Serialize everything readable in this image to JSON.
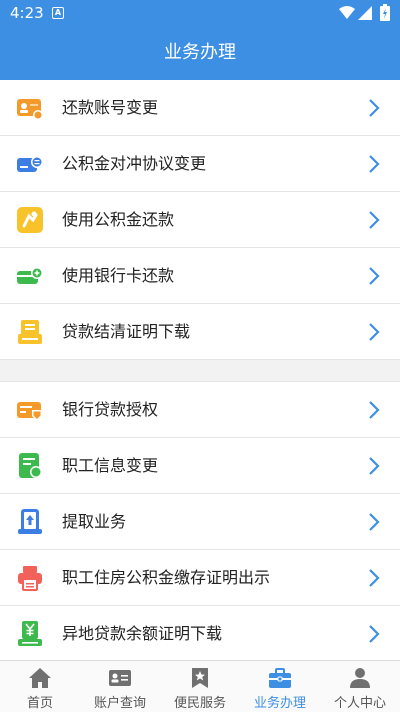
{
  "status": {
    "time": "4:23",
    "notif_badge": "A"
  },
  "header": {
    "title": "业务办理"
  },
  "section1": [
    {
      "label": "还款账号变更",
      "icon": "account-card-icon"
    },
    {
      "label": "公积金对冲协议变更",
      "icon": "offset-card-icon"
    },
    {
      "label": "使用公积金还款",
      "icon": "hand-coin-icon"
    },
    {
      "label": "使用银行卡还款",
      "icon": "bank-card-icon"
    },
    {
      "label": "贷款结清证明下载",
      "icon": "certificate-icon"
    }
  ],
  "section2": [
    {
      "label": "银行贷款授权",
      "icon": "authorization-icon"
    },
    {
      "label": "职工信息变更",
      "icon": "staff-info-icon"
    },
    {
      "label": "提取业务",
      "icon": "withdraw-icon"
    },
    {
      "label": "职工住房公积金缴存证明出示",
      "icon": "printer-icon"
    },
    {
      "label": "异地贷款余额证明下载",
      "icon": "yuan-download-icon"
    }
  ],
  "tabs": [
    {
      "label": "首页",
      "icon": "home-icon"
    },
    {
      "label": "账户查询",
      "icon": "id-card-icon"
    },
    {
      "label": "便民服务",
      "icon": "bookmark-star-icon"
    },
    {
      "label": "业务办理",
      "icon": "briefcase-icon",
      "active": true
    },
    {
      "label": "个人中心",
      "icon": "person-icon"
    }
  ],
  "colors": {
    "primary": "#3d8fe4",
    "orange": "#f39a2b",
    "green": "#3dba4e",
    "red": "#f2625a",
    "yellow": "#f7c22a",
    "blue": "#3d7ee4"
  }
}
